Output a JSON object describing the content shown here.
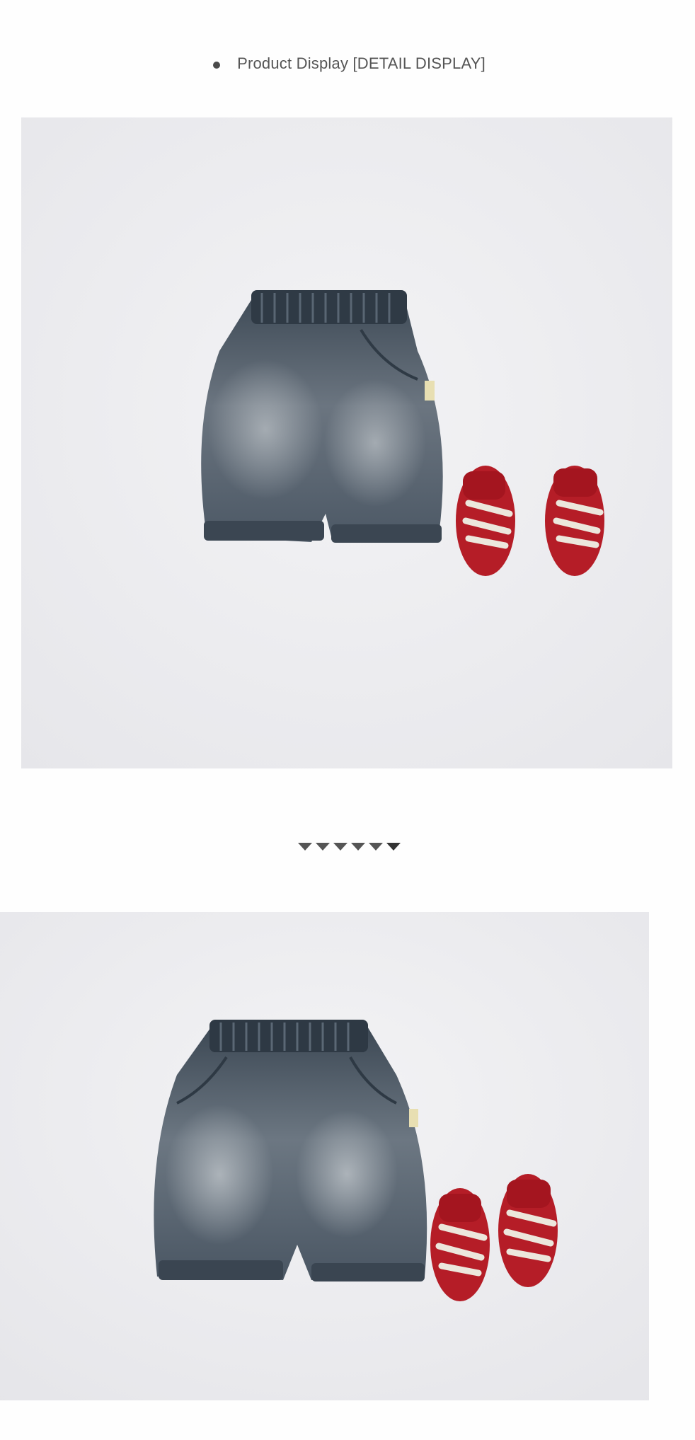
{
  "header": {
    "title": "Product Display [DETAIL DISPLAY]",
    "bullet_icon": "bullet-dot-icon"
  },
  "photos": [
    {
      "name": "product-photo-detail-1",
      "subject": "denim-bloomer-shorts-with-red-sneakers",
      "icon": "product-image"
    },
    {
      "name": "product-photo-detail-2",
      "subject": "denim-bloomer-shorts-with-red-sneakers",
      "icon": "product-image"
    }
  ],
  "scroll_indicator": {
    "icon": "down-arrow-icon",
    "count": 6
  },
  "colors": {
    "page_background": "#fefefe",
    "photo_background": "#eeeef1",
    "text": "#555555",
    "denim": "#4f5e6b",
    "shoe_red": "#c3202b"
  }
}
